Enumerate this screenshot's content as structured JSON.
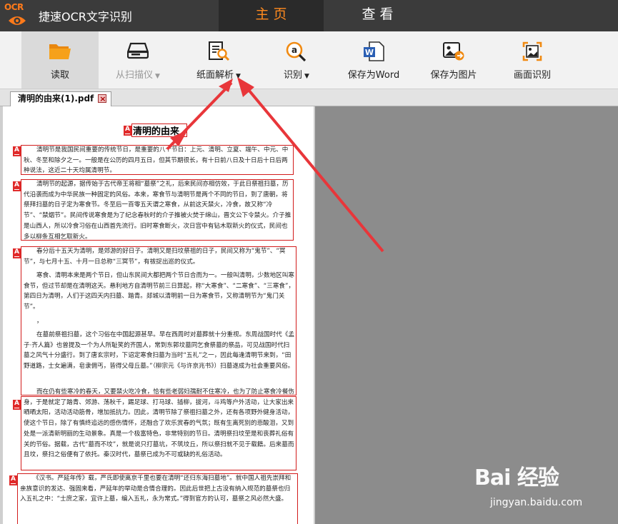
{
  "app": {
    "logo_text": "OCR",
    "title": "捷速OCR文字识别"
  },
  "tabs": [
    {
      "label": "主 页"
    },
    {
      "label": "查 看"
    }
  ],
  "toolbar": {
    "read": "读取",
    "scanner": "从扫描仪",
    "parse": "纸面解析",
    "recognize": "识别",
    "save_word": "保存为Word",
    "save_image": "保存为图片",
    "area_recognize": "画面识别"
  },
  "document": {
    "tab_label": "清明的由来(1).pdf",
    "title": "清明的由来",
    "paragraphs": [
      "清明节是我国民间重要的传统节日，是重要的八个节日：上元、清明、立夏、端午、中元、中秋、冬至和除夕之一。一般是在公历的四月五日，但其节期很长，有十日前八日及十日后十日后两种说法，这近二十天均属清明节。",
      "清明节的起源，据传始于古代帝王将相“墓祭”之礼，后来民间亦相仿效，于此日祭祖扫墓，历代沿袭而成为中华民族一种固定的风俗。本来，寒食节与清明节是两个不同的节日，到了唐朝，将祭拜扫墓的日子定为寒食节。冬至后一百零五天谓之寒食，从前这天禁火，冷食，故又称“冷节”、“禁烟节”。民间传说寒食是为了纪念春秋时的介子推被火焚于绵山，晋文公下令禁火。介子推是山西人，所以冷食习俗在山西首先流行。旧时寒食断火，次日宫中有钻木取新火的仪式，民间也多以柳条互相乞取新火。",
      "春分后十五天为清明，是郊游的好日子。清明又是扫坟祭祖的日子，民间又称为“鬼节”、“冥节”，与七月十五、十月一日总称“三冥节”，有祓捉出巡的仪式。",
      "寒食、清明本来是两个节日，但山东民间大都把两个节日合而为一。一般叫清明，少数地区叫寒食节，但过节却是在清明这天。悬利地方自清明节前三日算起，称“大寒食”、“二寒食”、“三寒食”，第四日为清明，人们于这四天内扫墓、踏青。郯城以清明前一日为寒食节，又称清明节为“鬼门关节”。",
      "，",
      "在墓前祭祖扫墓，这个习俗在中国起源甚早。早在西周时对墓葬就十分重视。东周战国时代《孟子·齐人篇》也曾提及一个为人所耻笑的齐国人，常到东郭坟墓同乞食祭墓的祭品，可见战国时代扫墓之风气十分盛行。到了唐玄宗时，下诏定寒食扫墓为当时“五礼”之一，因此每逢清明节来到，“田野道路，士女遍满，皂隶佣丐，皆得父母丘墓。”（柳宗元《与许京兆书》）扫墓遂成为社会重要风俗。",
      "而在仍有些寒冷的春天，又要禁火吃冷食，恰有些老弱妇孺耐不住寒冷，也为了防止寒食冷餐伤身，于是就定了踏青、郊游、荡秋千，踢足球、打马球、插柳，拔河，斗鸡等户外活动，让大家出来晒晒太阳，活动活动筋骨，增加抵抗力。因此，清明节除了祭祖扫墓之外，还有各项野外健身活动，使这个节日，除了有慎终追远的感伤情怀，还融合了欢乐赏春的气氛；既有生离死别的悲酸泪，又到处是一派清新明丽的生动景象。真是一个极富特色，非常特别的节日。清明祭扫坟茔是和丧葬礼俗有关的节俗。据载，古代“墓而不坟”，就是说只打墓坑，不筑坟丘，所以祭扫就不见于载籍。后来墓而且坟，祭扫之俗便有了依托。秦汉时代，墓祭已成为不可或缺的礼俗活动。",
      "《汉书。严延年传》载，严氏即使离京千里也要在清明“还归东海扫墓地”。就中国人祖先崇拜和亲族意识的发达、强固来看，严延年的举动是合情合理的。因此后世把上古没有纳入规范的墓祭也归入五礼之中：“士庶之家，宜许上墓，编入五礼，永为常式。”得到官方的认可，墓祭之风必然大盛。"
    ]
  },
  "watermark": {
    "brand": "Bai 经验",
    "url": "jingyan.baidu.com"
  },
  "colors": {
    "accent": "#ff8a1e",
    "titlebar": "#3b3b3b",
    "region_border": "#d21c1c",
    "arrow": "#e8363a"
  }
}
